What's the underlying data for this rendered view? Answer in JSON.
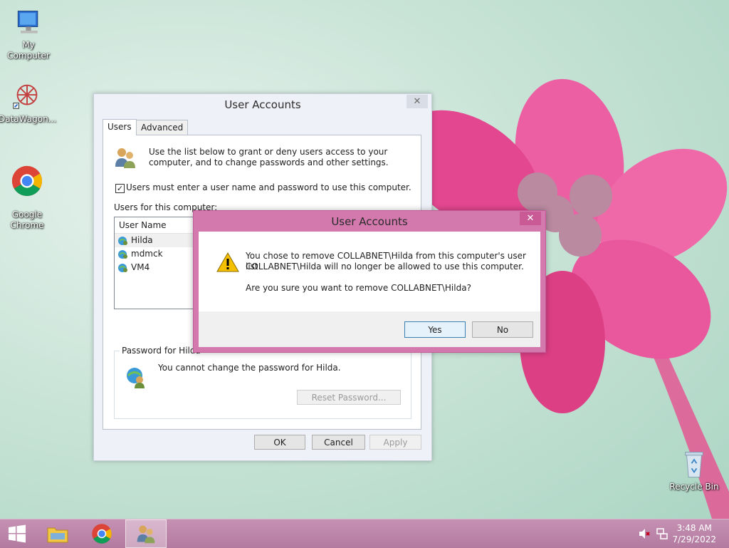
{
  "desktop": {
    "icons": [
      {
        "label": "My Computer"
      },
      {
        "label": "DataWagon..."
      },
      {
        "label": "Google\nChrome"
      },
      {
        "label": "Recycle Bin"
      }
    ]
  },
  "main_window": {
    "title": "User Accounts",
    "close": "✕",
    "tabs": [
      "Users",
      "Advanced"
    ],
    "intro": "Use the list below to grant or deny users access to your computer, and to change passwords and other settings.",
    "checkbox_label": "Users must enter a user name and password to use this computer.",
    "checkbox_checked": "✓",
    "users_label": "Users for this computer:",
    "list_header": "User Name",
    "users": [
      "Hilda",
      "mdmck",
      "VM4"
    ],
    "password_group": "Password for Hilda",
    "password_msg": "You cannot change the password for Hilda.",
    "reset_btn": "Reset Password...",
    "ok": "OK",
    "cancel": "Cancel",
    "apply": "Apply"
  },
  "dialog": {
    "title": "User Accounts",
    "close": "✕",
    "line1": "You chose to remove COLLABNET\\Hilda from this computer's user list.",
    "line2": "COLLABNET\\Hilda will no longer be allowed to use this computer.",
    "line3": "Are you sure you want to remove COLLABNET\\Hilda?",
    "yes": "Yes",
    "no": "No"
  },
  "taskbar": {
    "time": "3:48 AM",
    "date": "7/29/2022"
  },
  "colors": {
    "accent_dialog": "#d379ad",
    "taskbar": "#b37aa0"
  }
}
